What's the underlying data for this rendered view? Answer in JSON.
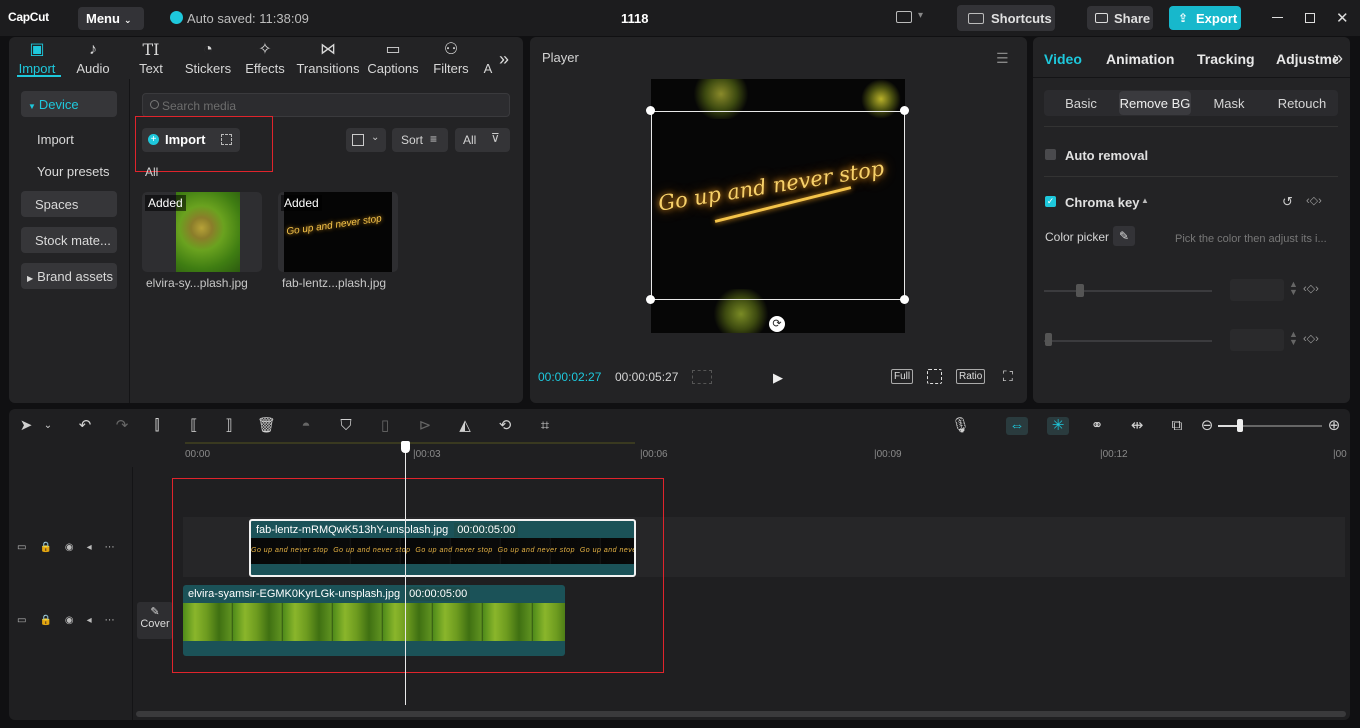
{
  "app": {
    "logo": "CapCut",
    "menu_label": "Menu",
    "save_status": "Auto saved: 11:38:09",
    "project_title": "1118",
    "shortcuts_label": "Shortcuts",
    "share_label": "Share",
    "export_label": "Export"
  },
  "media_tabs": [
    {
      "label": "Import",
      "icon": "import-icon"
    },
    {
      "label": "Audio",
      "icon": "audio-icon"
    },
    {
      "label": "Text",
      "icon": "text-icon"
    },
    {
      "label": "Stickers",
      "icon": "stickers-icon"
    },
    {
      "label": "Effects",
      "icon": "effects-icon"
    },
    {
      "label": "Transitions",
      "icon": "transitions-icon"
    },
    {
      "label": "Captions",
      "icon": "captions-icon"
    },
    {
      "label": "Filters",
      "icon": "filters-icon"
    },
    {
      "label": "A",
      "icon": "adjust-icon"
    }
  ],
  "sidebar": {
    "items": [
      "Device",
      "Import",
      "Your presets",
      "Spaces",
      "Stock mate...",
      "Brand assets"
    ]
  },
  "media": {
    "search_placeholder": "Search media",
    "import_label": "Import",
    "sort_label": "Sort",
    "filter_label": "All",
    "section_label": "All",
    "items": [
      {
        "badge": "Added",
        "name": "elvira-sy...plash.jpg"
      },
      {
        "badge": "Added",
        "name": "fab-lentz...plash.jpg"
      }
    ]
  },
  "player": {
    "title": "Player",
    "overlay_text": "Go up and never stop",
    "current_time": "00:00:02:27",
    "total_time": "00:00:05:27",
    "full_label": "Full",
    "ratio_label": "Ratio"
  },
  "props": {
    "tabs": [
      "Video",
      "Animation",
      "Tracking",
      "Adjustment"
    ],
    "subtabs": [
      "Basic",
      "Remove BG",
      "Mask",
      "Retouch"
    ],
    "auto_removal": "Auto removal",
    "chroma_key": "Chroma key",
    "color_picker": "Color picker",
    "color_hint": "Pick the color then adjust its i...",
    "accent": "#1ec8dc"
  },
  "timeline": {
    "ticks": [
      "00:00",
      "|00:03",
      "|00:06",
      "|00:09",
      "|00:12",
      "|00"
    ],
    "cover_label": "Cover",
    "clips": [
      {
        "name": "fab-lentz-mRMQwK513hY-unsplash.jpg",
        "duration": "00:00:05:00"
      },
      {
        "name": "elvira-syamsir-EGMK0KyrLGk-unsplash.jpg",
        "duration": "00:00:05:00"
      }
    ]
  }
}
